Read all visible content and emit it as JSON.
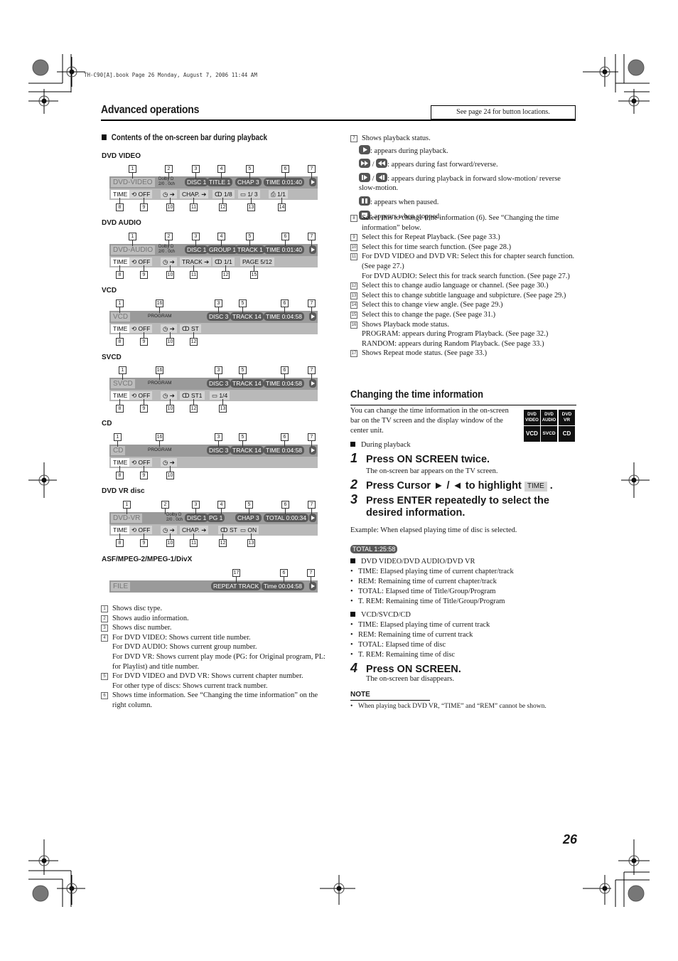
{
  "print_header": "TH-C90[A].book  Page 26  Monday, August 7, 2006  11:44 AM",
  "section_title": "Advanced operations",
  "see_page_note": "See page 24 for button locations.",
  "left": {
    "subheading": "Contents of the on-screen bar during playback",
    "bars": {
      "dvd_video": {
        "label": "DVD VIDEO",
        "disc_type": "DVD-VIDEO",
        "dolby": [
          "Dolby D",
          "2/0 . 0ch"
        ],
        "pills": [
          "DISC 1",
          "TITLE  1",
          "CHAP  3",
          "TIME   0:01:40"
        ],
        "bottom": [
          "TIME",
          "⟲ OFF",
          "◷ ➔",
          "CHAP. ➔",
          "ↀ 1/8",
          "▭ 1/ 3",
          "⎙ 1/1"
        ],
        "top_numbers": [
          "1",
          "2",
          "3",
          "4",
          "5",
          "6",
          "7"
        ],
        "bottom_numbers": [
          "8",
          "9",
          "10",
          "11",
          "12",
          "13",
          "14"
        ]
      },
      "dvd_audio": {
        "label": "DVD AUDIO",
        "disc_type": "DVD-AUDIO",
        "dolby": [
          "Dolby D",
          "2/0 . 0ch"
        ],
        "pills": [
          "DISC 1",
          "GROUP 1",
          "TRACK 1",
          "TIME   0:01:40"
        ],
        "bottom": [
          "TIME",
          "⟲ OFF",
          "◷ ➔",
          "TRACK ➔",
          "ↀ 1/1",
          "PAGE 5/12"
        ],
        "top_numbers": [
          "1",
          "2",
          "3",
          "4",
          "5",
          "6",
          "7"
        ],
        "bottom_numbers": [
          "8",
          "9",
          "10",
          "11",
          "12",
          "15"
        ]
      },
      "vcd": {
        "label": "VCD",
        "disc_type": "VCD",
        "program": "PROGRAM",
        "pills": [
          "DISC 3",
          "TRACK 14",
          "TIME   0:04:58"
        ],
        "bottom": [
          "TIME",
          "⟲ OFF",
          "◷ ➔",
          "ↀ ST"
        ],
        "top_numbers": [
          "1",
          "16",
          "3",
          "5",
          "6",
          "7"
        ],
        "bottom_numbers": [
          "8",
          "9",
          "10",
          "12"
        ]
      },
      "svcd": {
        "label": "SVCD",
        "disc_type": "SVCD",
        "program": "PROGRAM",
        "pills": [
          "DISC 3",
          "TRACK 14",
          "TIME   0:04:58"
        ],
        "bottom": [
          "TIME",
          "⟲ OFF",
          "◷ ➔",
          "ↀ ST1",
          "▭   1/4"
        ],
        "top_numbers": [
          "1",
          "16",
          "3",
          "5",
          "6",
          "7"
        ],
        "bottom_numbers": [
          "8",
          "9",
          "10",
          "12",
          "13"
        ]
      },
      "cd": {
        "label": "CD",
        "disc_type": "CD",
        "program": "PROGRAM",
        "pills": [
          "DISC 3",
          "TRACK 14",
          "TIME   0:04:58"
        ],
        "bottom": [
          "TIME",
          "⟲ OFF",
          "◷ ➔"
        ],
        "top_numbers": [
          "1",
          "16",
          "3",
          "5",
          "6",
          "7"
        ],
        "bottom_numbers": [
          "8",
          "9",
          "10"
        ]
      },
      "dvd_vr": {
        "label": "DVD VR disc",
        "disc_type": "DVD-VR",
        "dolby": [
          "Dolby D",
          "2/0 . 0ch"
        ],
        "pills": [
          "DISC 1",
          "PG       1",
          "CHAP  3",
          "TOTAL  0:00:34"
        ],
        "bottom": [
          "TIME",
          "⟲ OFF",
          "◷ ➔",
          "CHAP. ➔",
          "ↀ ST",
          "▭  ON"
        ],
        "top_numbers": [
          "1",
          "2",
          "3",
          "4",
          "5",
          "6",
          "7"
        ],
        "bottom_numbers": [
          "8",
          "9",
          "10",
          "11",
          "12",
          "13"
        ]
      },
      "file": {
        "label": "ASF/MPEG-2/MPEG-1/DivX",
        "disc_type": "FILE",
        "pills": [
          "REPEAT TRACK",
          "Time  00:04:58"
        ],
        "top_numbers": [
          "17",
          "6",
          "7"
        ]
      }
    },
    "legend": [
      {
        "n": "1",
        "lines": [
          "Shows disc type."
        ]
      },
      {
        "n": "2",
        "lines": [
          "Shows audio information."
        ]
      },
      {
        "n": "3",
        "lines": [
          "Shows disc number."
        ]
      },
      {
        "n": "4",
        "lines": [
          "For DVD VIDEO: Shows current title number.",
          "For DVD AUDIO: Shows current group number.",
          "For DVD VR: Shows current play mode (PG: for Original program, PL: for Playlist) and title number."
        ]
      },
      {
        "n": "5",
        "lines": [
          "For DVD VIDEO and DVD VR: Shows current chapter number.",
          "For other type of discs: Shows current track number."
        ]
      },
      {
        "n": "6",
        "lines": [
          "Shows time information. See “Changing the time information” on the right column."
        ]
      }
    ]
  },
  "right": {
    "item7": {
      "n": "7",
      "title": "Shows playback status.",
      "states": [
        ": appears during playback.",
        ": appears during fast forward/reverse.",
        ": appears during playback in forward slow-motion/ reverse slow-motion.",
        ": appears when paused.",
        ": appears when stopped."
      ]
    },
    "legend": [
      {
        "n": "8",
        "lines": [
          "Select this to change time information (6). See “Changing the time information” below."
        ]
      },
      {
        "n": "9",
        "lines": [
          "Select this for Repeat Playback. (See page 33.)"
        ]
      },
      {
        "n": "10",
        "lines": [
          "Select this for time search function. (See page 28.)"
        ]
      },
      {
        "n": "11",
        "lines": [
          "For DVD VIDEO and DVD VR: Select this for chapter search function. (See page 27.)",
          "For DVD AUDIO: Select this for track search function. (See page 27.)"
        ]
      },
      {
        "n": "12",
        "lines": [
          "Select this to change audio language or channel. (See page 30.)"
        ]
      },
      {
        "n": "13",
        "lines": [
          "Select this to change subtitle language and subpicture. (See page 29.)"
        ]
      },
      {
        "n": "14",
        "lines": [
          "Select this to change view angle. (See page 29.)"
        ]
      },
      {
        "n": "15",
        "lines": [
          "Select this to change the page. (See page 31.)"
        ]
      },
      {
        "n": "16",
        "lines": [
          "Shows Playback mode status.",
          "PROGRAM: appears during Program Playback. (See page 32.)",
          "RANDOM: appears during Random Playback. (See page 33.)"
        ]
      },
      {
        "n": "17",
        "lines": [
          "Shows Repeat mode status. (See page 33.)"
        ]
      }
    ],
    "changing": {
      "title": "Changing the time information",
      "intro": "You can change the time information in the on-screen bar on the TV screen and the display window of the center unit.",
      "badges": [
        {
          "top": "DVD",
          "bot": "VIDEO"
        },
        {
          "top": "DVD",
          "bot": "AUDIO"
        },
        {
          "top": "DVD",
          "bot": "VR"
        },
        {
          "top": "VCD",
          "bot": ""
        },
        {
          "top": "SVCD",
          "bot": ""
        },
        {
          "top": "CD",
          "bot": ""
        }
      ],
      "condition": "During playback",
      "steps": [
        {
          "n": "1",
          "text": "Press ON SCREEN twice.",
          "sub": "The on-screen bar appears on the TV screen."
        },
        {
          "n": "2",
          "text_pre": "Press Cursor ► / ◄ to highlight",
          "chip": "TIME",
          "text_post": "."
        },
        {
          "n": "3",
          "text": "Press ENTER repeatedly to select the desired information."
        },
        {
          "n": "4",
          "text": "Press ON SCREEN.",
          "sub": "The on-screen bar disappears."
        }
      ],
      "example": "Example: When elapsed playing time of disc is selected.",
      "example_pill": "TOTAL  1:25:58",
      "group1": {
        "title": "DVD VIDEO/DVD AUDIO/DVD VR",
        "items": [
          "TIME: Elapsed playing time of current chapter/track",
          "REM: Remaining time of current chapter/track",
          "TOTAL: Elapsed time of Title/Group/Program",
          "T. REM: Remaining time of Title/Group/Program"
        ]
      },
      "group2": {
        "title": "VCD/SVCD/CD",
        "items": [
          "TIME: Elapsed playing time of current track",
          "REM: Remaining time of current track",
          "TOTAL: Elapsed time of disc",
          "T. REM: Remaining time of disc"
        ]
      },
      "note_heading": "NOTE",
      "note": "When playing back DVD VR, “TIME” and “REM” cannot be shown."
    }
  },
  "page_number": "26"
}
